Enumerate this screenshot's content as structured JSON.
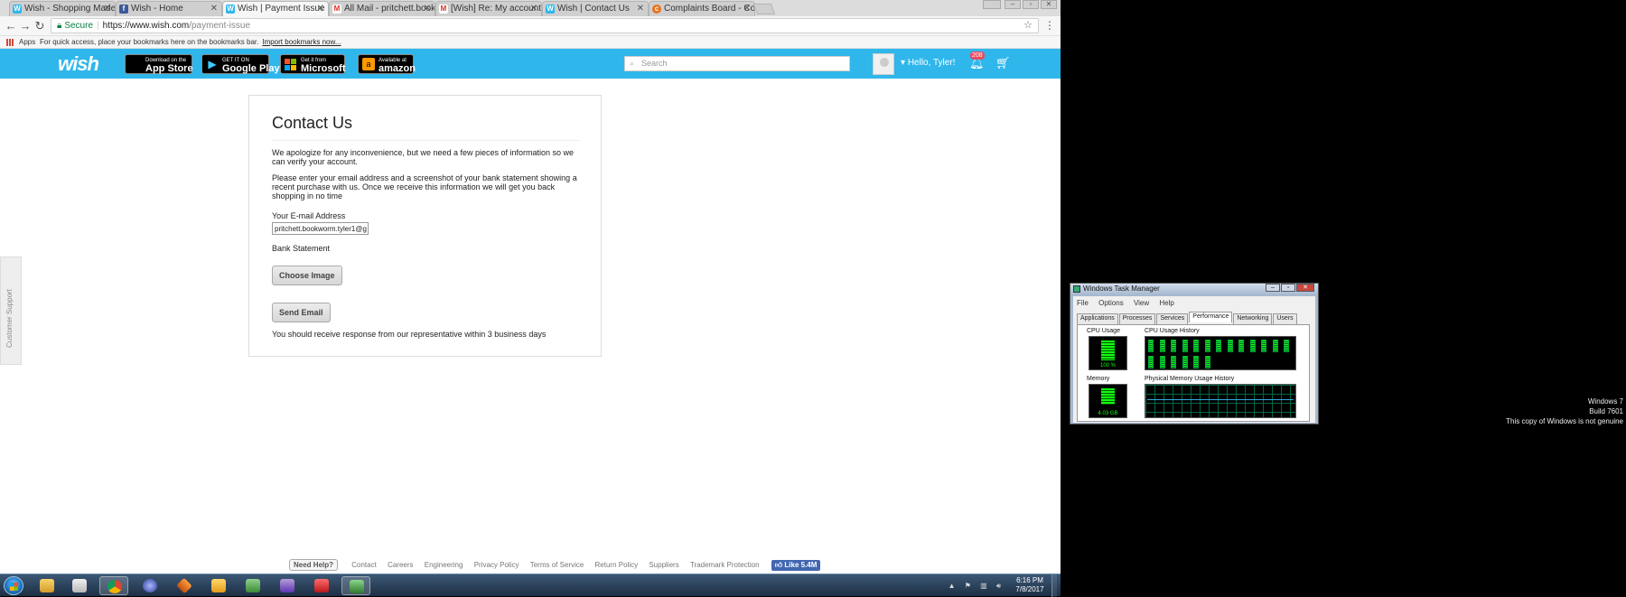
{
  "browser": {
    "tabs": [
      {
        "title": "Wish - Shopping Made F",
        "favicon": "wish-icon",
        "active": false
      },
      {
        "title": "Wish - Home",
        "favicon": "facebook-icon",
        "active": false
      },
      {
        "title": "Wish | Payment Issue",
        "favicon": "wish-icon",
        "active": true
      },
      {
        "title": "All Mail - pritchett.bookw",
        "favicon": "gmail-icon",
        "active": false
      },
      {
        "title": "[Wish] Re: My account su",
        "favicon": "gmail-icon",
        "active": false
      },
      {
        "title": "Wish | Contact Us",
        "favicon": "wish-icon",
        "active": false
      },
      {
        "title": "Complaints Board - Comp",
        "favicon": "complaints-board-icon",
        "active": false
      }
    ],
    "address": {
      "secure_label": "Secure",
      "url_host": "https://www.wish.com",
      "url_path": "/payment-issue"
    },
    "bookmarks": {
      "apps_label": "Apps",
      "hint": "For quick access, place your bookmarks here on the bookmarks bar.",
      "import_link": "Import bookmarks now..."
    }
  },
  "wish_header": {
    "logo": "wish",
    "badges": [
      {
        "small": "Download on the",
        "big": "App Store"
      },
      {
        "small": "GET IT ON",
        "big": "Google Play"
      },
      {
        "small": "Get it from",
        "big": "Microsoft"
      },
      {
        "small": "Available at",
        "big": "amazon"
      }
    ],
    "search_placeholder": "Search",
    "greeting": "Hello, Tyler!",
    "notification_count": "208"
  },
  "contact": {
    "title": "Contact Us",
    "para1": "We apologize for any inconvenience, but we need a few pieces of information so we can verify your account.",
    "para2": "Please enter your email address and a screenshot of your bank statement showing a recent purchase with us. Once we receive this information we will get you back shopping in no time",
    "email_label": "Your E-mail Address",
    "email_value": "pritchett.bookworm.tyler1@g",
    "bank_label": "Bank Statement",
    "choose_button": "Choose Image",
    "send_button": "Send Email",
    "response_note": "You should receive response from our representative within 3 business days"
  },
  "support_tab": "Customer Support",
  "footer": {
    "need_help": "Need Help?",
    "links": [
      "Contact",
      "Careers",
      "Engineering",
      "Privacy Policy",
      "Terms of Service",
      "Return Policy",
      "Suppliers",
      "Trademark Protection"
    ],
    "like": "Like 5.4M"
  },
  "task_manager": {
    "title": "Windows Task Manager",
    "menu": [
      "File",
      "Options",
      "View",
      "Help"
    ],
    "tabs": [
      "Applications",
      "Processes",
      "Services",
      "Performance",
      "Networking",
      "Users"
    ],
    "active_tab": "Performance",
    "cpu_label": "CPU Usage",
    "cpu_value": "100 %",
    "cpu_history_label": "CPU Usage History",
    "memory_label": "Memory",
    "memory_value": "4.03 GB",
    "memory_history_label": "Physical Memory Usage History"
  },
  "watermark": {
    "line1": "Windows 7",
    "line2": "Build 7601",
    "line3": "This copy of Windows is not genuine"
  },
  "taskbar": {
    "time": "6:16 PM",
    "date": "7/8/2017"
  },
  "colors": {
    "wish_blue": "#2fb7ec",
    "notification": "#e84a5f",
    "taskbar": "#1d2f44"
  }
}
